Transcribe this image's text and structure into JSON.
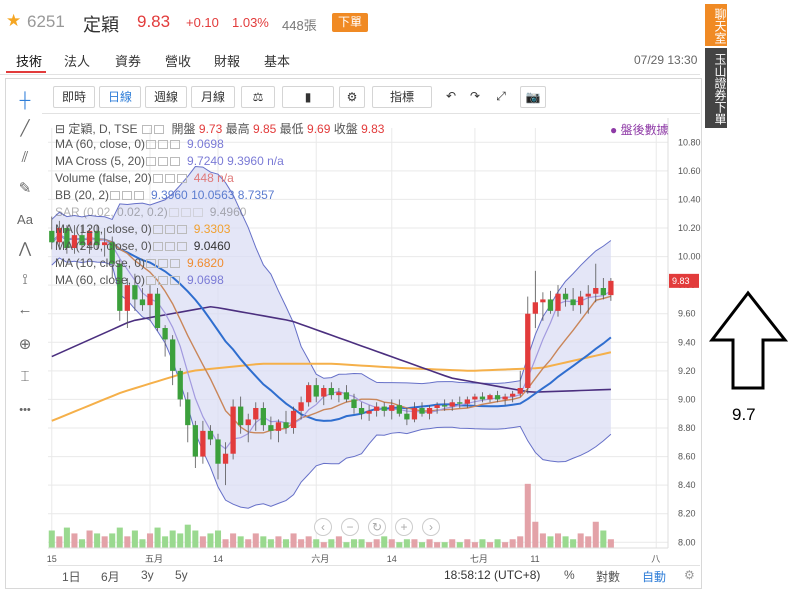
{
  "header": {
    "code": "6251",
    "name": "定穎",
    "price": "9.83",
    "change": "+0.10",
    "change_pct": "1.03%",
    "volume": "448張",
    "order_label": "下單",
    "price_color": "#e23b3b"
  },
  "tabs": [
    "技術",
    "法人",
    "資券",
    "營收",
    "財報",
    "基本"
  ],
  "active_tab": "技術",
  "datetime": "07/29 13:30",
  "side_labels": [
    "聊天室",
    "玉山證券下單"
  ],
  "toolbar": {
    "items": [
      "即時",
      "日線",
      "週線",
      "月線",
      "⚖",
      "▮",
      "⚙",
      "指標",
      "↶",
      "↷",
      "⤢",
      "📷"
    ],
    "active": "日線"
  },
  "sidebar_icons": [
    "crosshair-icon",
    "trendline-icon",
    "pitchfork-icon",
    "brush-icon",
    "text-icon",
    "pattern-icon",
    "measure-icon",
    "arrow-left-icon",
    "zoom-icon",
    "ruler-icon",
    "more-icon"
  ],
  "sidebar_glyphs": [
    "┼",
    "╱",
    "⫽",
    "✎",
    "Aa",
    "⋀",
    "⟟",
    "←",
    "⊕",
    "⌶",
    "•••"
  ],
  "sidebar_text_label": "Aa",
  "legend": {
    "title": "定穎, D, TSE",
    "ohlc": {
      "open_label": "開盤",
      "open": "9.73",
      "high_label": "最高",
      "high": "9.85",
      "low_label": "最低",
      "low": "9.69",
      "close_label": "收盤",
      "close": "9.83"
    },
    "after_hours": "● 盤後數據",
    "rows": [
      {
        "label": "MA (60, close, 0)",
        "value": "9.0698",
        "color": "#7b7bd6"
      },
      {
        "label": "MA Cross (5, 20)",
        "value": "9.7240  9.3960  n/a",
        "color": "#7b7bd6"
      },
      {
        "label": "Volume (false, 20)",
        "value": "448  n/a",
        "color": "#e07a7a"
      },
      {
        "label": "BB (20, 2)",
        "value": "9.3960  10.0563  8.7357",
        "color": "#5b7ccf"
      },
      {
        "label": "SAR (0.02, 0.02, 0.2)",
        "value": "9.4960",
        "color": "#9aa0c8"
      },
      {
        "label": "MA (120, close, 0)",
        "value": "9.3303",
        "color": "#f0a030"
      },
      {
        "label": "MA (240, close, 0)",
        "value": "9.0460",
        "color": "#333333"
      },
      {
        "label": "MA (10, close, 0)",
        "value": "9.6820",
        "color": "#f08c30"
      },
      {
        "label": "MA (60, close, 0)",
        "value": "9.0698",
        "color": "#7b7bd6"
      }
    ]
  },
  "bottom": {
    "ranges": [
      "1日",
      "6月",
      "3y",
      "5y"
    ],
    "clock": "18:58:12 (UTC+8)",
    "pct": "%",
    "log": "對數",
    "auto": "自動",
    "gear": "⚙"
  },
  "zoom_controls": [
    "‹",
    "−",
    "↻",
    "+",
    "›"
  ],
  "annotation": {
    "text": "9.7"
  },
  "chart_data": {
    "type": "candlestick",
    "y_ticks": [
      "10.80",
      "10.60",
      "10.40",
      "10.20",
      "10.00",
      "9.80",
      "9.60",
      "9.40",
      "9.20",
      "9.00",
      "8.80",
      "8.60",
      "8.40",
      "8.20",
      "8.00"
    ],
    "ylim": [
      7.96,
      10.9
    ],
    "x_ticks": [
      "15",
      "五月",
      "14",
      "六月",
      "14",
      "七月",
      "11",
      "八"
    ],
    "x_tick_index": [
      0,
      13,
      22,
      35,
      45,
      56,
      64,
      80
    ],
    "last_price_label": "9.83",
    "colors": {
      "up": "#e23b3b",
      "down": "#3ca03c",
      "bb_fill": "#d9dbf3",
      "bb_line": "#6670c8",
      "ma_blue": "#2f6ecf",
      "ma_purple": "#4b2f7f",
      "ma_orange": "#f5b04a",
      "ma_brown": "#c9865a",
      "ma_lilac": "#a29adf",
      "vol_up": "#e3a2a8",
      "vol_down": "#9ad98f"
    },
    "candles": [
      [
        10.18,
        10.28,
        10.05,
        10.1
      ],
      [
        10.1,
        10.25,
        10.05,
        10.2
      ],
      [
        10.2,
        10.22,
        10.02,
        10.06
      ],
      [
        10.06,
        10.22,
        10.02,
        10.15
      ],
      [
        10.15,
        10.22,
        10.05,
        10.08
      ],
      [
        10.08,
        10.2,
        10.02,
        10.18
      ],
      [
        10.18,
        10.22,
        10.05,
        10.08
      ],
      [
        10.08,
        10.2,
        10.0,
        10.1
      ],
      [
        10.1,
        10.14,
        9.85,
        9.95
      ],
      [
        9.95,
        9.98,
        9.55,
        9.62
      ],
      [
        9.62,
        9.85,
        9.5,
        9.8
      ],
      [
        9.8,
        9.88,
        9.62,
        9.7
      ],
      [
        9.7,
        9.78,
        9.62,
        9.66
      ],
      [
        9.66,
        9.8,
        9.55,
        9.74
      ],
      [
        9.74,
        9.78,
        9.48,
        9.5
      ],
      [
        9.5,
        9.52,
        9.3,
        9.42
      ],
      [
        9.42,
        9.45,
        9.1,
        9.2
      ],
      [
        9.2,
        9.22,
        8.95,
        9.0
      ],
      [
        9.0,
        9.05,
        8.7,
        8.82
      ],
      [
        8.82,
        8.85,
        8.52,
        8.6
      ],
      [
        8.6,
        8.85,
        8.55,
        8.78
      ],
      [
        8.78,
        8.82,
        8.68,
        8.72
      ],
      [
        8.72,
        8.76,
        8.44,
        8.55
      ],
      [
        8.55,
        8.7,
        8.4,
        8.62
      ],
      [
        8.62,
        9.0,
        8.58,
        8.95
      ],
      [
        8.95,
        9.02,
        8.76,
        8.82
      ],
      [
        8.82,
        8.9,
        8.7,
        8.86
      ],
      [
        8.86,
        8.98,
        8.78,
        8.94
      ],
      [
        8.94,
        8.98,
        8.78,
        8.82
      ],
      [
        8.82,
        8.88,
        8.72,
        8.78
      ],
      [
        8.78,
        8.86,
        8.7,
        8.84
      ],
      [
        8.84,
        8.92,
        8.76,
        8.8
      ],
      [
        8.8,
        8.95,
        8.76,
        8.92
      ],
      [
        8.92,
        9.02,
        8.86,
        8.98
      ],
      [
        8.98,
        9.12,
        8.95,
        9.1
      ],
      [
        9.1,
        9.15,
        8.98,
        9.02
      ],
      [
        9.02,
        9.1,
        8.96,
        9.08
      ],
      [
        9.08,
        9.12,
        9.0,
        9.03
      ],
      [
        9.03,
        9.08,
        8.98,
        9.05
      ],
      [
        9.05,
        9.1,
        8.98,
        9.0
      ],
      [
        9.0,
        9.04,
        8.9,
        8.94
      ],
      [
        8.94,
        8.98,
        8.86,
        8.9
      ],
      [
        8.9,
        8.96,
        8.85,
        8.92
      ],
      [
        8.92,
        8.98,
        8.88,
        8.95
      ],
      [
        8.95,
        8.98,
        8.88,
        8.92
      ],
      [
        8.92,
        9.0,
        8.86,
        8.96
      ],
      [
        8.96,
        9.0,
        8.88,
        8.9
      ],
      [
        8.9,
        8.94,
        8.82,
        8.86
      ],
      [
        8.86,
        8.98,
        8.84,
        8.94
      ],
      [
        8.94,
        8.98,
        8.88,
        8.9
      ],
      [
        8.9,
        8.96,
        8.86,
        8.94
      ],
      [
        8.94,
        8.98,
        8.9,
        8.96
      ],
      [
        8.96,
        9.0,
        8.92,
        8.95
      ],
      [
        8.95,
        9.0,
        8.92,
        8.98
      ],
      [
        8.98,
        9.02,
        8.94,
        8.97
      ],
      [
        8.97,
        9.02,
        8.94,
        9.0
      ],
      [
        9.0,
        9.04,
        8.96,
        9.02
      ],
      [
        9.02,
        9.05,
        8.98,
        9.0
      ],
      [
        9.0,
        9.04,
        8.98,
        9.03
      ],
      [
        9.03,
        9.06,
        8.98,
        9.0
      ],
      [
        9.0,
        9.04,
        8.96,
        9.02
      ],
      [
        9.02,
        9.06,
        8.98,
        9.04
      ],
      [
        9.04,
        9.2,
        9.02,
        9.08
      ],
      [
        9.08,
        9.72,
        9.04,
        9.6
      ],
      [
        9.6,
        9.9,
        9.5,
        9.68
      ],
      [
        9.68,
        9.75,
        9.55,
        9.7
      ],
      [
        9.7,
        9.76,
        9.6,
        9.62
      ],
      [
        9.62,
        9.8,
        9.58,
        9.74
      ],
      [
        9.74,
        9.78,
        9.65,
        9.7
      ],
      [
        9.7,
        9.78,
        9.62,
        9.66
      ],
      [
        9.66,
        9.76,
        9.6,
        9.72
      ],
      [
        9.72,
        9.8,
        9.6,
        9.74
      ],
      [
        9.74,
        9.95,
        9.68,
        9.78
      ],
      [
        9.78,
        9.85,
        9.7,
        9.73
      ],
      [
        9.73,
        9.85,
        9.69,
        9.83
      ]
    ],
    "volume": [
      0.6,
      0.4,
      0.7,
      0.5,
      0.3,
      0.6,
      0.5,
      0.4,
      0.5,
      0.7,
      0.4,
      0.6,
      0.3,
      0.5,
      0.7,
      0.4,
      0.6,
      0.5,
      0.8,
      0.6,
      0.4,
      0.5,
      0.6,
      0.3,
      0.5,
      0.4,
      0.3,
      0.5,
      0.4,
      0.3,
      0.4,
      0.3,
      0.5,
      0.3,
      0.4,
      0.3,
      0.2,
      0.3,
      0.4,
      0.2,
      0.3,
      0.3,
      0.2,
      0.3,
      0.4,
      0.3,
      0.2,
      0.3,
      0.3,
      0.2,
      0.3,
      0.2,
      0.2,
      0.3,
      0.2,
      0.3,
      0.2,
      0.3,
      0.2,
      0.3,
      0.2,
      0.3,
      0.4,
      2.2,
      0.9,
      0.5,
      0.4,
      0.5,
      0.4,
      0.3,
      0.5,
      0.4,
      0.9,
      0.6,
      0.3
    ]
  }
}
